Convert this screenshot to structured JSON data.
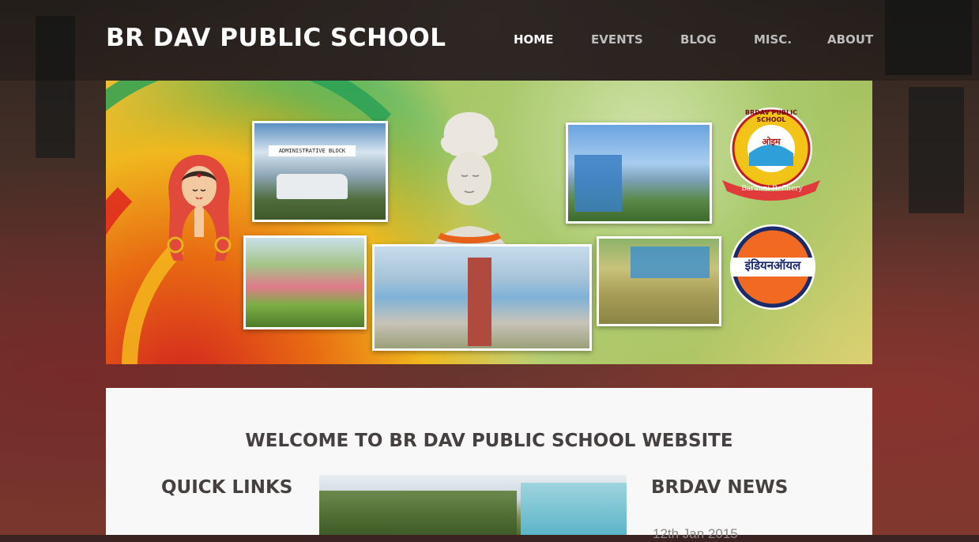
{
  "site": {
    "title": "BR DAV PUBLIC SCHOOL"
  },
  "nav": {
    "items": [
      {
        "label": "HOME"
      },
      {
        "label": "EVENTS"
      },
      {
        "label": "BLOG"
      },
      {
        "label": "MISC."
      },
      {
        "label": "ABOUT"
      }
    ],
    "active": "HOME"
  },
  "banner": {
    "photo_labels": {
      "admin_block": "ADMINISTRATIVE BLOCK",
      "logo_top": "BRDAV PUBLIC SCHOOL",
      "logo_om": "ओइम",
      "logo_bottom": "Barauni Refinery",
      "indian_oil": "इंडियनऑयल"
    }
  },
  "content": {
    "welcome": "WELCOME TO BR DAV PUBLIC SCHOOL WEBSITE",
    "quick_links_title": "QUICK LINKS",
    "news_title": "BRDAV NEWS",
    "news_date": "12th Jan 2015"
  },
  "colors": {
    "title_text": "#ffffff",
    "nav_inactive": "#bdbdbd",
    "heading_text": "#474040",
    "content_bg": "#f8f8f8",
    "indian_oil_orange": "#f26a21",
    "indian_oil_navy": "#1b2a6b"
  }
}
